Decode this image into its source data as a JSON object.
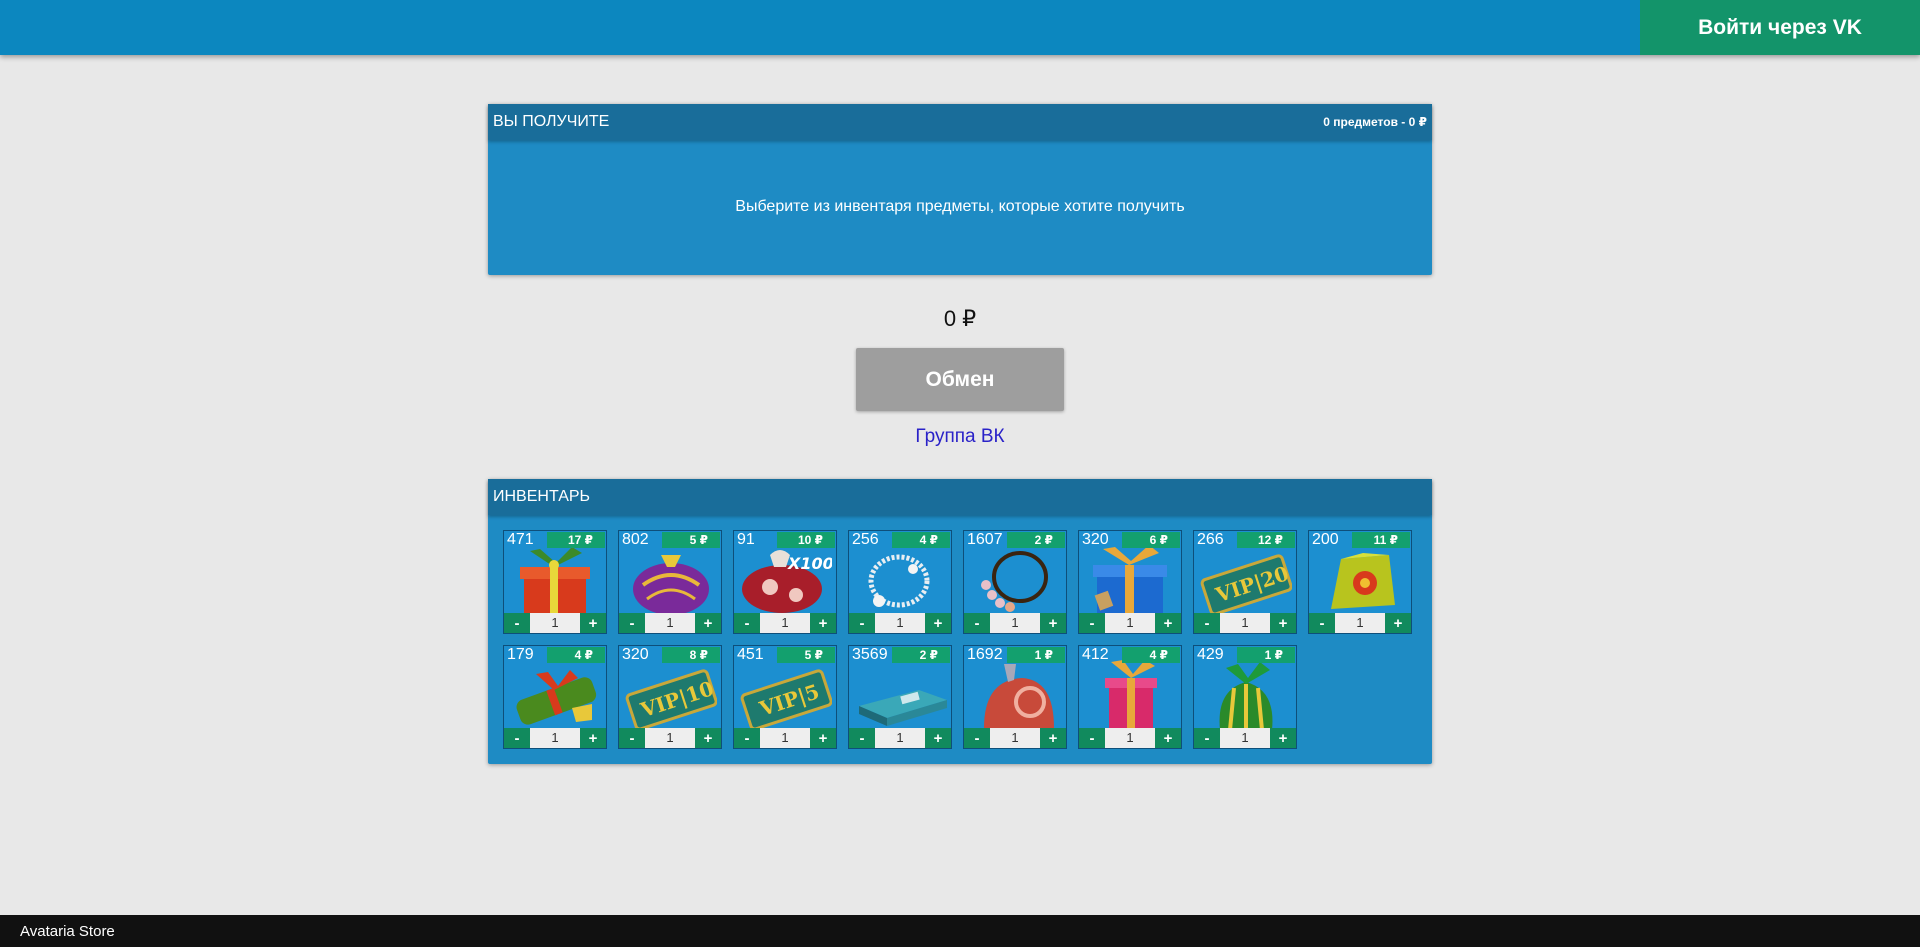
{
  "header": {
    "login_label": "Войти через VK"
  },
  "receive": {
    "title": "ВЫ ПОЛУЧИТЕ",
    "count": "0 предметов - 0 ₽",
    "hint": "Выберите из инвентаря предметы, которые хотите получить"
  },
  "total": "0 ₽",
  "exchange_label": "Обмен",
  "vk_group_label": "Группа ВК",
  "inventory": {
    "title": "ИНВЕНТАРЬ",
    "items": [
      {
        "qty": "471",
        "price": "17 ₽",
        "count": "1",
        "icon": "red-gift-box-icon"
      },
      {
        "qty": "802",
        "price": "5 ₽",
        "count": "1",
        "icon": "purple-ornament-icon"
      },
      {
        "qty": "91",
        "price": "10 ₽",
        "count": "1",
        "icon": "candy-bag-x100-icon"
      },
      {
        "qty": "256",
        "price": "4 ₽",
        "count": "1",
        "icon": "pearl-necklace-icon"
      },
      {
        "qty": "1607",
        "price": "2 ₽",
        "count": "1",
        "icon": "bead-necklace-icon"
      },
      {
        "qty": "320",
        "price": "6 ₽",
        "count": "1",
        "icon": "blue-gift-box-icon"
      },
      {
        "qty": "266",
        "price": "12 ₽",
        "count": "1",
        "icon": "vip-20-ticket-icon"
      },
      {
        "qty": "200",
        "price": "11 ₽",
        "count": "1",
        "icon": "yellow-gift-icon"
      },
      {
        "qty": "179",
        "price": "4 ₽",
        "count": "1",
        "icon": "green-wrapped-gift-icon"
      },
      {
        "qty": "320",
        "price": "8 ₽",
        "count": "1",
        "icon": "vip-10-ticket-icon"
      },
      {
        "qty": "451",
        "price": "5 ₽",
        "count": "1",
        "icon": "vip-5-ticket-icon"
      },
      {
        "qty": "3569",
        "price": "2 ₽",
        "count": "1",
        "icon": "teal-box-icon"
      },
      {
        "qty": "1692",
        "price": "1 ₽",
        "count": "1",
        "icon": "red-piggy-bank-icon"
      },
      {
        "qty": "412",
        "price": "4 ₽",
        "count": "1",
        "icon": "pink-gift-box-icon"
      },
      {
        "qty": "429",
        "price": "1 ₽",
        "count": "1",
        "icon": "green-striped-gift-icon"
      }
    ]
  },
  "footer": "Avataria Store"
}
